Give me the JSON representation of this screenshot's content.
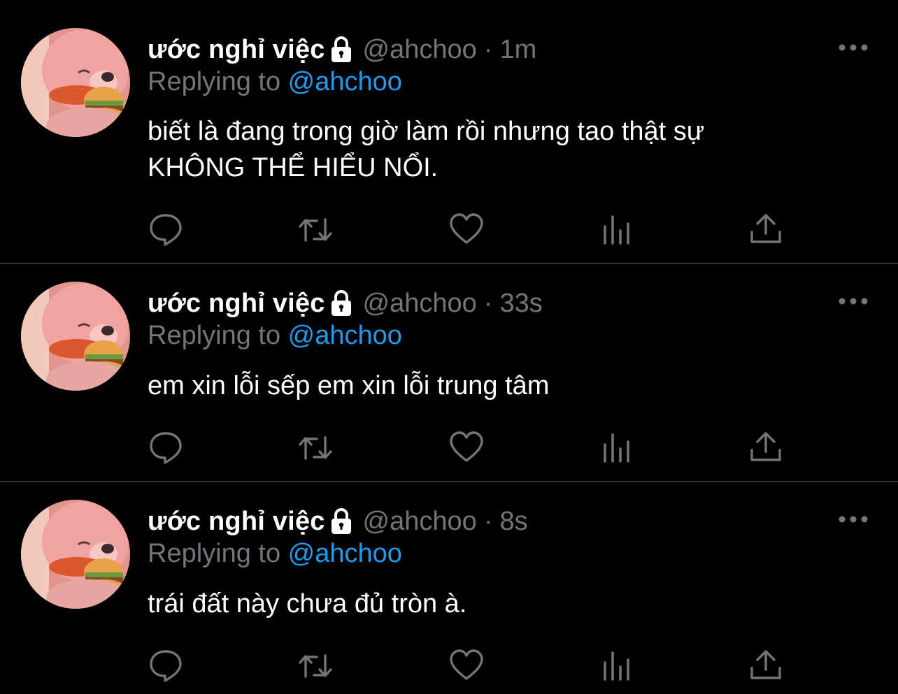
{
  "colors": {
    "background": "#000000",
    "name": "#ffffff",
    "muted": "#71767b",
    "mention": "#1d9bf0",
    "divider": "#2f3336",
    "icon": "#71767b"
  },
  "tweets": [
    {
      "name": "ước nghỉ việc",
      "handle": "@ahchoo",
      "separator": "·",
      "time": "1m",
      "replying_prefix": "Replying to ",
      "replying_to": "@ahchoo",
      "text_lines": [
        "biết là đang trong giờ làm rồi nhưng tao thật sự",
        "KHÔNG THỂ HIỂU NỔI."
      ],
      "icons": {
        "lock": "lock-icon",
        "more": "more-icon",
        "reply": "reply-icon",
        "retweet": "retweet-icon",
        "like": "heart-icon",
        "views": "views-icon",
        "share": "share-icon"
      }
    },
    {
      "name": "ước nghỉ việc",
      "handle": "@ahchoo",
      "separator": "·",
      "time": "33s",
      "replying_prefix": "Replying to ",
      "replying_to": "@ahchoo",
      "text_lines": [
        "em xin lỗi sếp em xin lỗi trung tâm"
      ],
      "icons": {
        "lock": "lock-icon",
        "more": "more-icon",
        "reply": "reply-icon",
        "retweet": "retweet-icon",
        "like": "heart-icon",
        "views": "views-icon",
        "share": "share-icon"
      }
    },
    {
      "name": "ước nghỉ việc",
      "handle": "@ahchoo",
      "separator": "·",
      "time": "8s",
      "replying_prefix": "Replying to ",
      "replying_to": "@ahchoo",
      "text_lines": [
        "trái đất này chưa đủ tròn à."
      ],
      "icons": {
        "lock": "lock-icon",
        "more": "more-icon",
        "reply": "reply-icon",
        "retweet": "retweet-icon",
        "like": "heart-icon",
        "views": "views-icon",
        "share": "share-icon"
      }
    }
  ]
}
